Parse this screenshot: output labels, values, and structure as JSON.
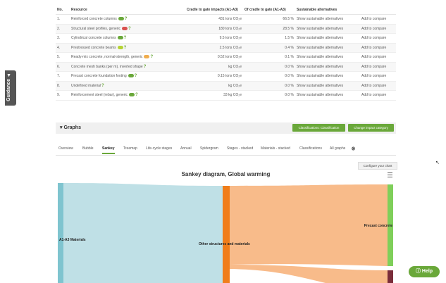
{
  "guidance_label": "Guidance ▲",
  "table": {
    "headers": [
      "No.",
      "Resource",
      "Cradle to gate impacts (A1-A3)",
      "Of cradle to gate (A1-A3)",
      "Sustainable alternatives",
      ""
    ],
    "rows": [
      {
        "no": "1.",
        "resource": "Reinforced concrete columns",
        "impact": "431 tons CO₂e",
        "share": "66.5 %",
        "alt": "Show sustainable alternatives",
        "compare": "Add to compare",
        "cloud": "#6aa83a"
      },
      {
        "no": "2.",
        "resource": "Structural steel profiles, generic",
        "impact": "180 tons CO₂e",
        "share": "28.5 %",
        "alt": "Show sustainable alternatives",
        "compare": "Add to compare",
        "cloud": "#d9534f"
      },
      {
        "no": "3.",
        "resource": "Cylindrical concrete columns",
        "impact": "9.5 tons CO₂e",
        "share": "1.5 %",
        "alt": "Show sustainable alternatives",
        "compare": "Add to compare",
        "cloud": "#6aa83a"
      },
      {
        "no": "4.",
        "resource": "Prestressed concrete beams",
        "impact": "2.5 tons CO₂e",
        "share": "0.4 %",
        "alt": "Show sustainable alternatives",
        "compare": "Add to compare",
        "cloud": "#b5d334"
      },
      {
        "no": "5.",
        "resource": "Ready-mix concrete, normal-strength, generic",
        "impact": "0.52 tons CO₂e",
        "share": "0.1 %",
        "alt": "Show sustainable alternatives",
        "compare": "Add to compare",
        "cloud": "#f0ad4e"
      },
      {
        "no": "6.",
        "resource": "Concrete mesh banks (per m), inverted shape",
        "impact": "kg CO₂e",
        "share": "0.0 %",
        "alt": "Show sustainable alternatives",
        "compare": "Add to compare",
        "cloud": ""
      },
      {
        "no": "7.",
        "resource": "Precast concrete foundation footing",
        "impact": "0.15 tons CO₂e",
        "share": "0.0 %",
        "alt": "Show sustainable alternatives",
        "compare": "Add to compare",
        "cloud": "#6aa83a"
      },
      {
        "no": "8.",
        "resource": "Undefined material",
        "impact": "kg CO₂e",
        "share": "0.0 %",
        "alt": "Show sustainable alternatives",
        "compare": "Add to compare",
        "cloud": ""
      },
      {
        "no": "9.",
        "resource": "Reinforcement steel (rebar), generic",
        "impact": "33 kg CO₂e",
        "share": "0.0 %",
        "alt": "Show sustainable alternatives",
        "compare": "Add to compare",
        "cloud": "#6aa83a"
      }
    ]
  },
  "graphs": {
    "title": "Graphs",
    "classification_btn": "Classifications: Classification",
    "impact_btn": "Change impact category"
  },
  "tabs": [
    "Overview",
    "Bubble",
    "Sankey",
    "Treemap",
    "Life-cycle stages",
    "Annual",
    "Spidergram",
    "Stages - stacked",
    "Materials - stacked",
    "Classifications",
    "All graphs"
  ],
  "active_tab": "Sankey",
  "configure_label": "Configure your chart",
  "chart_data": {
    "type": "sankey",
    "title": "Sankey diagram, Global warming",
    "nodes": [
      "A1-A3 Materials",
      "Other structures and materials",
      "Precast concrete"
    ]
  },
  "help_label": "Help",
  "colors": {
    "accent": "#6aa83a",
    "node_a": "#7fc4cf",
    "node_b": "#f07d1a",
    "node_c": "#7fcf5a",
    "node_d": "#7a2d3a",
    "link_a": "#bfe0e6",
    "link_b": "#f8bb8a"
  }
}
